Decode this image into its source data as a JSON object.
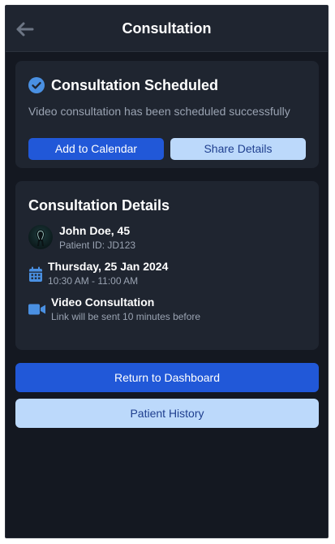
{
  "header": {
    "title": "Consultation",
    "back_icon": "arrow-left-icon"
  },
  "status_card": {
    "title": "Consultation Scheduled",
    "message": "Video consultation has been scheduled successfully",
    "icon": "check-circle-icon",
    "add_to_calendar_label": "Add to Calendar",
    "share_details_label": "Share Details"
  },
  "details_card": {
    "title": "Consultation Details",
    "patient": {
      "name_age": "John Doe, 45",
      "id_text": "Patient ID: JD123"
    },
    "schedule": {
      "date": "Thursday, 25 Jan 2024",
      "time": "10:30 AM - 11:00 AM",
      "icon": "calendar-icon"
    },
    "mode": {
      "type": "Video Consultation",
      "note": "Link will be sent 10 minutes before",
      "icon": "video-camera-icon"
    }
  },
  "actions": {
    "return_label": "Return to Dashboard",
    "history_label": "Patient History"
  },
  "colors": {
    "background": "#141821",
    "card": "#1f2530",
    "primary": "#2158d8",
    "secondary": "#bcd9fb",
    "accent_icon": "#4a90e2"
  }
}
